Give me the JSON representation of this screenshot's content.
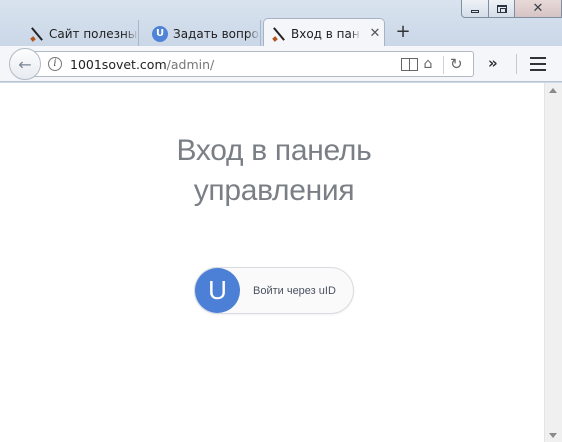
{
  "window": {
    "controls": {
      "minimize": "",
      "maximize": "",
      "close": "✕"
    }
  },
  "tabs": [
    {
      "label": "Сайт полезных",
      "icon": "pencil-icon",
      "active": false
    },
    {
      "label": "Задать вопрос",
      "icon": "u-icon",
      "active": false
    },
    {
      "label": "Вход в панель",
      "icon": "pencil-icon",
      "active": true,
      "close": "✕"
    }
  ],
  "tab_u_letter": "U",
  "new_tab_label": "+",
  "navbar": {
    "back_label": "←",
    "info_label": "i",
    "url_host": "1001sovet.com",
    "url_path": "/admin/",
    "reload_label": "↻",
    "overflow_label": "»"
  },
  "page": {
    "heading_line1": "Вход в панель",
    "heading_line2": "управления",
    "uid_button": {
      "letter": "U",
      "label": "Войти через uID"
    }
  },
  "colors": {
    "accent": "#4c7fd6",
    "heading": "#7a7f86"
  }
}
